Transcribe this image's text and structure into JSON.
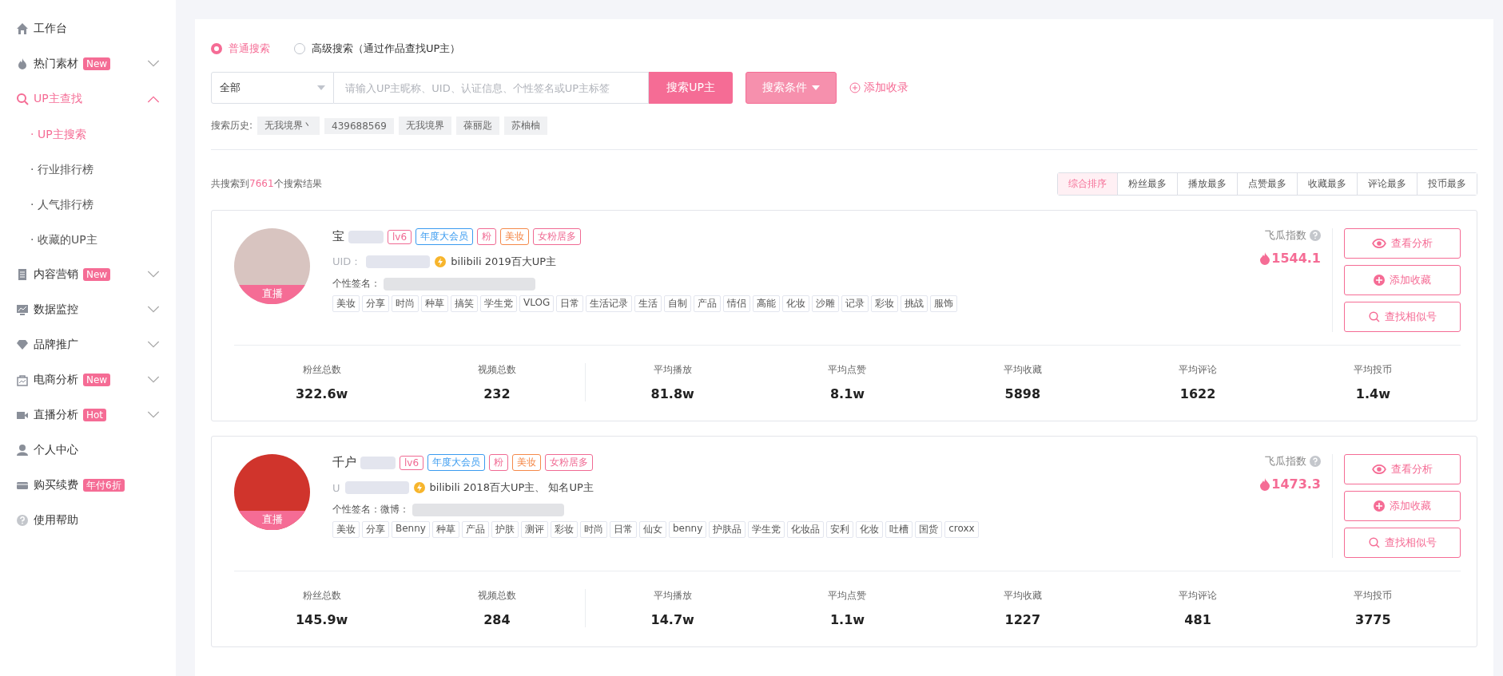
{
  "sidebar": {
    "items": [
      {
        "label": "工作台"
      },
      {
        "label": "热门素材",
        "badge": "New",
        "expanded": false
      },
      {
        "label": "UP主查找",
        "expanded": true,
        "selected": true,
        "children": [
          {
            "label": "· UP主搜索",
            "selected": true
          },
          {
            "label": "· 行业排行榜",
            "selected": false
          },
          {
            "label": "· 人气排行榜",
            "selected": false
          },
          {
            "label": "· 收藏的UP主",
            "selected": false
          }
        ]
      },
      {
        "label": "内容营销",
        "badge": "New",
        "expanded": false
      },
      {
        "label": "数据监控",
        "expanded": false
      },
      {
        "label": "品牌推广",
        "expanded": false
      },
      {
        "label": "电商分析",
        "badge": "New",
        "expanded": false
      },
      {
        "label": "直播分析",
        "badge": "Hot",
        "expanded": false
      },
      {
        "label": "个人中心"
      },
      {
        "label": "购买续费",
        "badge": "年付6折"
      },
      {
        "label": "使用帮助"
      }
    ]
  },
  "search": {
    "modes": [
      {
        "label": "普通搜索",
        "selected": true
      },
      {
        "label": "高级搜索（通过作品查找UP主）",
        "selected": false
      }
    ],
    "scope": "全部",
    "placeholder": "请输入UP主昵称、UID、认证信息、个性签名或UP主标签",
    "submit": "搜索UP主",
    "conditions": "搜索条件",
    "add": "添加收录",
    "history_label": "搜索历史:",
    "history": [
      "无我境界丶",
      "439688569",
      "无我境界",
      "葆丽匙",
      "苏柚柚"
    ]
  },
  "result_count": {
    "before": "共搜索到",
    "count": "7661",
    "after": "个搜索结果"
  },
  "sort_tabs": [
    {
      "label": "综合排序",
      "selected": true
    },
    {
      "label": "粉丝最多",
      "selected": false
    },
    {
      "label": "播放最多",
      "selected": false
    },
    {
      "label": "点赞最多",
      "selected": false
    },
    {
      "label": "收藏最多",
      "selected": false
    },
    {
      "label": "评论最多",
      "selected": false
    },
    {
      "label": "投币最多",
      "selected": false
    }
  ],
  "results": [
    {
      "name": "宝",
      "live": "直播",
      "tags": [
        {
          "label": "lv6",
          "color": "#f06a93"
        },
        {
          "label": "年度大会员",
          "color": "#3a9bf0"
        },
        {
          "label": "粉",
          "color": "#f06a93"
        },
        {
          "label": "美妆",
          "color": "#f5894a"
        },
        {
          "label": "女粉居多",
          "color": "#f06a93"
        }
      ],
      "uid_label": "UID：",
      "cert": "bilibili 2019百大UP主",
      "signature_label": "个性签名：",
      "labels": [
        "美妆",
        "分享",
        "时尚",
        "种草",
        "搞笑",
        "学生党",
        "VLOG",
        "日常",
        "生活记录",
        "生活",
        "自制",
        "产品",
        "情侣",
        "高能",
        "化妆",
        "沙雕",
        "记录",
        "彩妆",
        "挑战",
        "服饰"
      ],
      "index_label": "飞瓜指数",
      "index": "1544.1",
      "actions": [
        "查看分析",
        "添加收藏",
        "查找相似号"
      ],
      "stats": [
        {
          "label": "粉丝总数",
          "value": "322.6w"
        },
        {
          "label": "视频总数",
          "value": "232"
        },
        {
          "label": "平均播放",
          "value": "81.8w"
        },
        {
          "label": "平均点赞",
          "value": "8.1w"
        },
        {
          "label": "平均收藏",
          "value": "5898"
        },
        {
          "label": "平均评论",
          "value": "1622"
        },
        {
          "label": "平均投币",
          "value": "1.4w"
        }
      ]
    },
    {
      "name": "千户",
      "live": "直播",
      "tags": [
        {
          "label": "lv6",
          "color": "#f06a93"
        },
        {
          "label": "年度大会员",
          "color": "#3a9bf0"
        },
        {
          "label": "粉",
          "color": "#f06a93"
        },
        {
          "label": "美妆",
          "color": "#f5894a"
        },
        {
          "label": "女粉居多",
          "color": "#f06a93"
        }
      ],
      "uid_label": "U",
      "cert": "bilibili 2018百大UP主、 知名UP主",
      "signature_label": "个性签名：微博：",
      "labels": [
        "美妆",
        "分享",
        "Benny",
        "种草",
        "产品",
        "护肤",
        "测评",
        "彩妆",
        "时尚",
        "日常",
        "仙女",
        "benny",
        "护肤品",
        "学生党",
        "化妆品",
        "安利",
        "化妆",
        "吐槽",
        "国货",
        "croxx"
      ],
      "index_label": "飞瓜指数",
      "index": "1473.3",
      "actions": [
        "查看分析",
        "添加收藏",
        "查找相似号"
      ],
      "stats": [
        {
          "label": "粉丝总数",
          "value": "145.9w"
        },
        {
          "label": "视频总数",
          "value": "284"
        },
        {
          "label": "平均播放",
          "value": "14.7w"
        },
        {
          "label": "平均点赞",
          "value": "1.1w"
        },
        {
          "label": "平均收藏",
          "value": "1227"
        },
        {
          "label": "平均评论",
          "value": "481"
        },
        {
          "label": "平均投币",
          "value": "3775"
        }
      ]
    }
  ]
}
